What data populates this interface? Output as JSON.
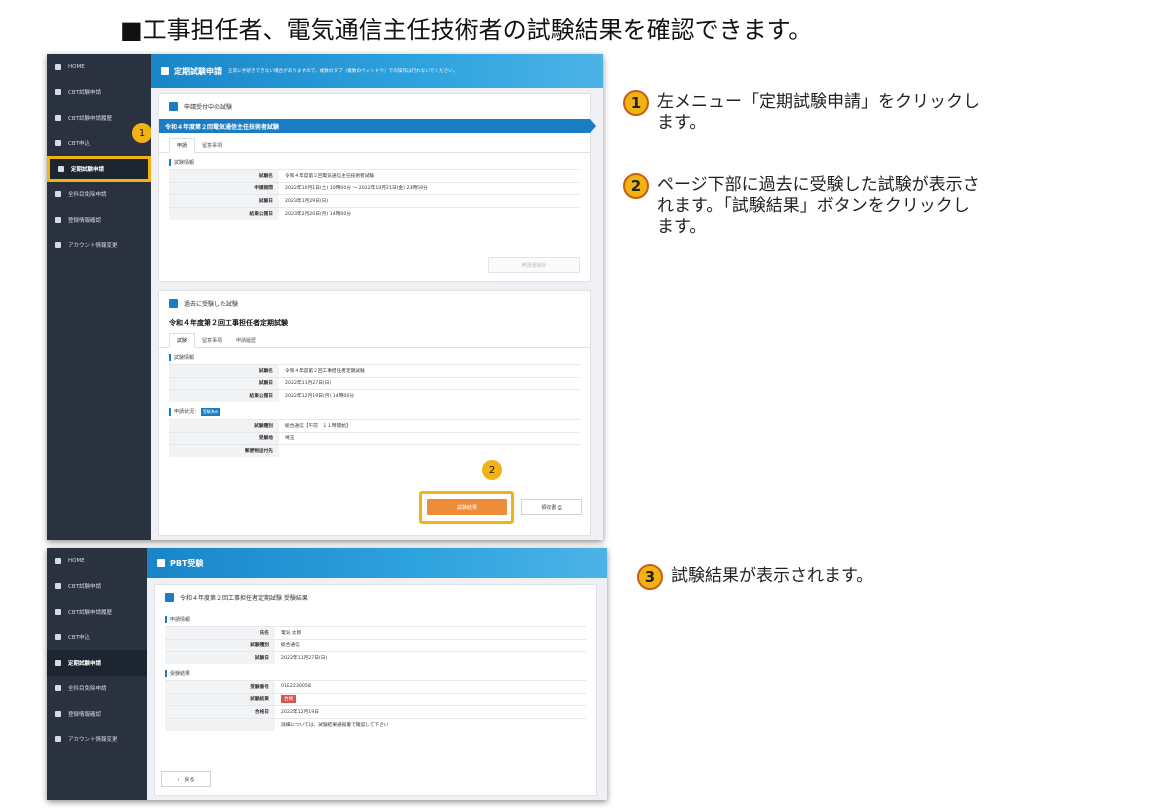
{
  "page_title": "■工事担任者、電気通信主任技術者の試験結果を確認できます。",
  "colors": {
    "accent_yellow": "#f1b214",
    "sidebar_bg": "#2a3240",
    "header_blue": "#1985c9",
    "primary_blue": "#1a7cc2",
    "orange_button": "#ef8c3a",
    "pass_red": "#d9534f"
  },
  "sidebar_items": [
    {
      "label": "HOME",
      "icon": "home-icon"
    },
    {
      "label": "CBT試験申請",
      "icon": "document-icon"
    },
    {
      "label": "CBT試験申請履歴",
      "icon": "tag-icon"
    },
    {
      "label": "CBT申込",
      "icon": "pencil-icon"
    },
    {
      "label": "定期試験申請",
      "icon": "document-icon"
    },
    {
      "label": "全科目免除申請",
      "icon": "document-icon"
    },
    {
      "label": "登録情報確認",
      "icon": "user-icon"
    },
    {
      "label": "アカウント情報変更",
      "icon": "lock-icon"
    }
  ],
  "shot1": {
    "header_title": "定期試験申請",
    "header_note": "正常に手続きできない場合がありますので、複数のタブ（複数のウィンドウ）での操作は行わないでください。",
    "accepting": {
      "heading": "申請受付中の試験",
      "banner_title": "令和４年度第２回電気通信主任技術者試験",
      "tabs": [
        "申請",
        "留意事項"
      ],
      "section_label": "試験情報",
      "rows": [
        {
          "k": "試験名",
          "v": "令和４年度第２回電気通信主任技術者試験"
        },
        {
          "k": "申請期間",
          "v": "2022年10月1日(土) 10時00分 ～ 2022年10月21日(金) 23時59分"
        },
        {
          "k": "試験日",
          "v": "2023年1月29日(日)"
        },
        {
          "k": "結果公開日",
          "v": "2023年2月20日(月) 14時00分"
        }
      ],
      "apply_button": "申請書除外"
    },
    "past": {
      "heading": "過去に受験した試験",
      "exam_title": "令和４年度第２回工事担任者定期試験",
      "tabs": [
        "試験",
        "留意事項",
        "申請履歴"
      ],
      "section_label": "試験情報",
      "rows": [
        {
          "k": "試験名",
          "v": "令和４年度第２回工事担任者定期試験"
        },
        {
          "k": "試験日",
          "v": "2022年11月27日(日)"
        },
        {
          "k": "結果公開日",
          "v": "2022年12月19日(月) 14時00分"
        }
      ],
      "status_label": "申請状況：",
      "status_badge": "受験済み",
      "status_rows": [
        {
          "k": "試験種別",
          "v": "総合通信【午前　１１時開始】"
        },
        {
          "k": "受験地",
          "v": "埼玉"
        },
        {
          "k": "郵便物送付先",
          "v": ""
        }
      ],
      "result_button": "試験結果",
      "receipt_button": "領収書 ⎙"
    },
    "marker_1": "1",
    "marker_2": "2"
  },
  "shot2": {
    "header_title": "PBT受験",
    "result_heading": "令和４年度第２回工事担任者定期試験 受験結果",
    "apply_section": "申請情報",
    "apply_rows": [
      {
        "k": "氏名",
        "v": "電気 太郎"
      },
      {
        "k": "試験種別",
        "v": "総合通信"
      },
      {
        "k": "試験日",
        "v": "2022年11月27日(日)"
      }
    ],
    "result_section": "受験結果",
    "result_rows": [
      {
        "k": "受験番号",
        "v": "01E2230058"
      },
      {
        "k": "試験結果",
        "v": "合格"
      },
      {
        "k": "合格日",
        "v": "2022年12月19日"
      },
      {
        "k": "",
        "v": "詳細については、試験結果通知書で確認して下さい"
      }
    ],
    "back_button": "‹　戻る"
  },
  "steps": [
    {
      "num": "1",
      "text": "左メニュー「定期試験申請」をクリックし\nます。"
    },
    {
      "num": "2",
      "text": "ページ下部に過去に受験した試験が表示さ\nれます。「試験結果」ボタンをクリックし\nます。"
    },
    {
      "num": "3",
      "text": "試験結果が表示されます。"
    }
  ]
}
